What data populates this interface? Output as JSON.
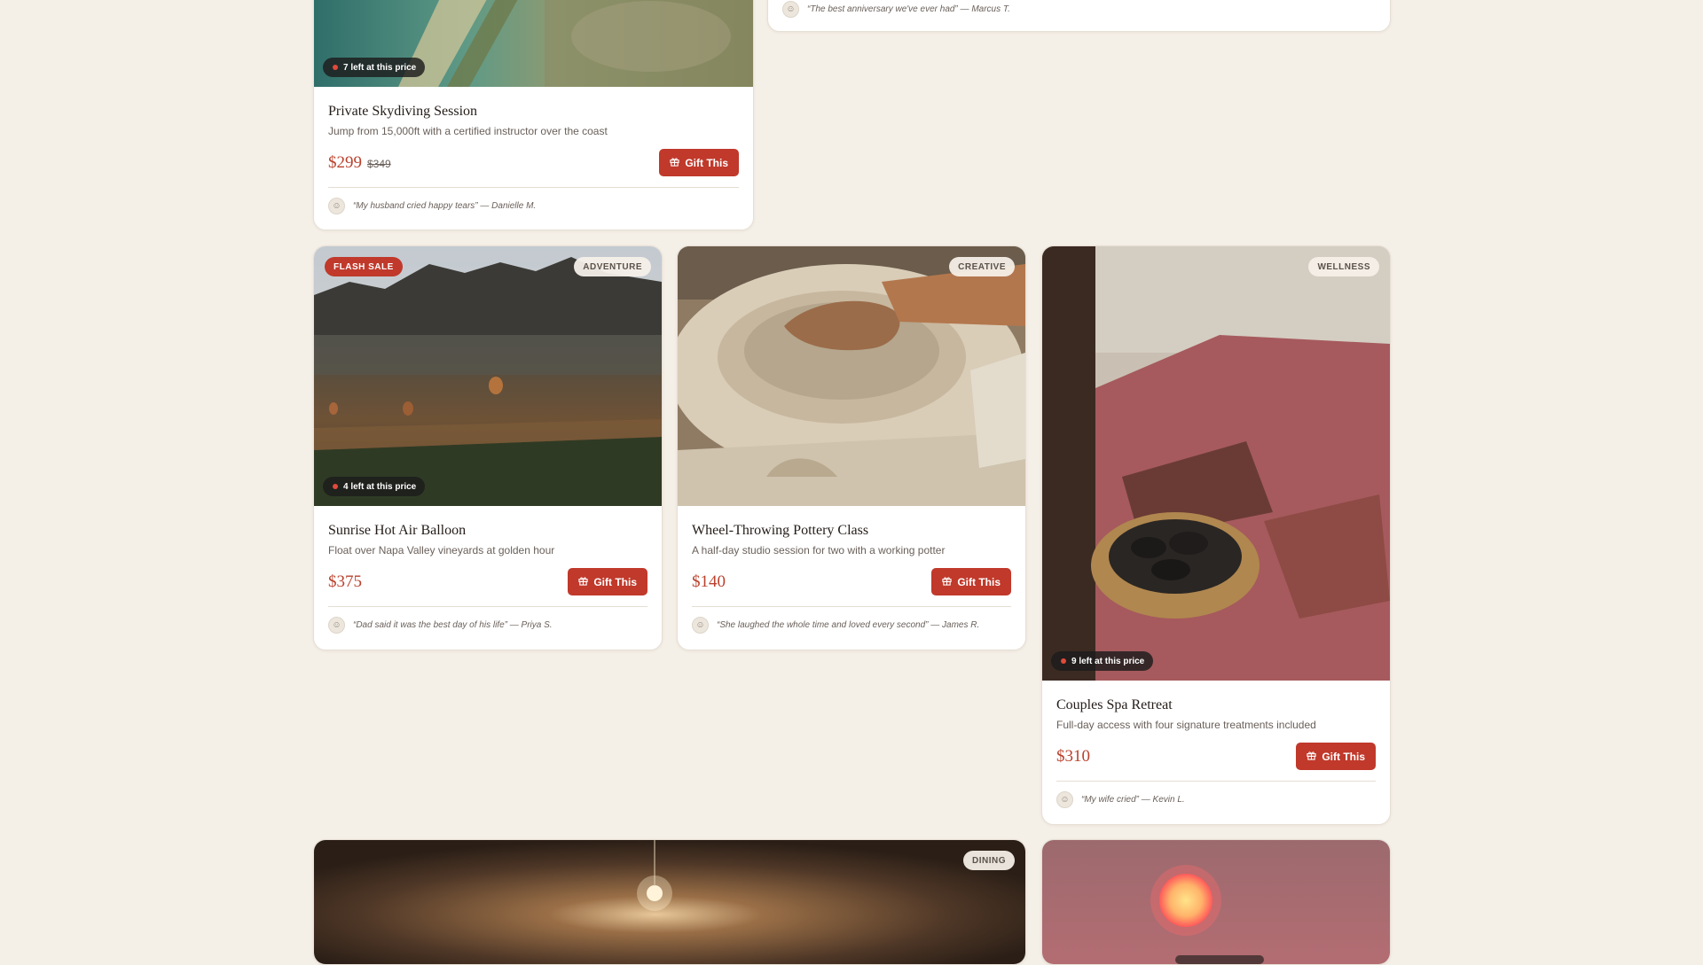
{
  "colors": {
    "page_bg": "#f4efe7",
    "accent": "#c0392b",
    "price": "#b9412d"
  },
  "cards": {
    "skydiving": {
      "title": "Private Skydiving Session",
      "description": "Jump from 15,000ft with a certified instructor over the coast",
      "price": "$299",
      "old_price": "$349",
      "stock": "7 left at this price",
      "cta": "Gift This",
      "quote": "“My husband cried happy tears” — Danielle M."
    },
    "anniversary": {
      "quote": "“The best anniversary we've ever had” — Marcus T."
    },
    "balloon": {
      "badge_flash": "FLASH SALE",
      "category": "ADVENTURE",
      "title": "Sunrise Hot Air Balloon",
      "description": "Float over Napa Valley vineyards at golden hour",
      "price": "$375",
      "stock": "4 left at this price",
      "cta": "Gift This",
      "quote": "“Dad said it was the best day of his life” — Priya S."
    },
    "pottery": {
      "category": "CREATIVE",
      "title": "Wheel-Throwing Pottery Class",
      "description": "A half-day studio session for two with a working potter",
      "price": "$140",
      "cta": "Gift This",
      "quote": "“She laughed the whole time and loved every second” — James R."
    },
    "spa": {
      "category": "WELLNESS",
      "title": "Couples Spa Retreat",
      "description": "Full-day access with four signature treatments included",
      "price": "$310",
      "stock": "9 left at this price",
      "cta": "Gift This",
      "quote": "“My wife cried” — Kevin L."
    },
    "wine_cave": {
      "category": "DINING"
    },
    "sunset": {}
  },
  "icons": {
    "gift": "gift-icon",
    "avatar": "user-icon",
    "stock_dot": "dot-icon"
  }
}
